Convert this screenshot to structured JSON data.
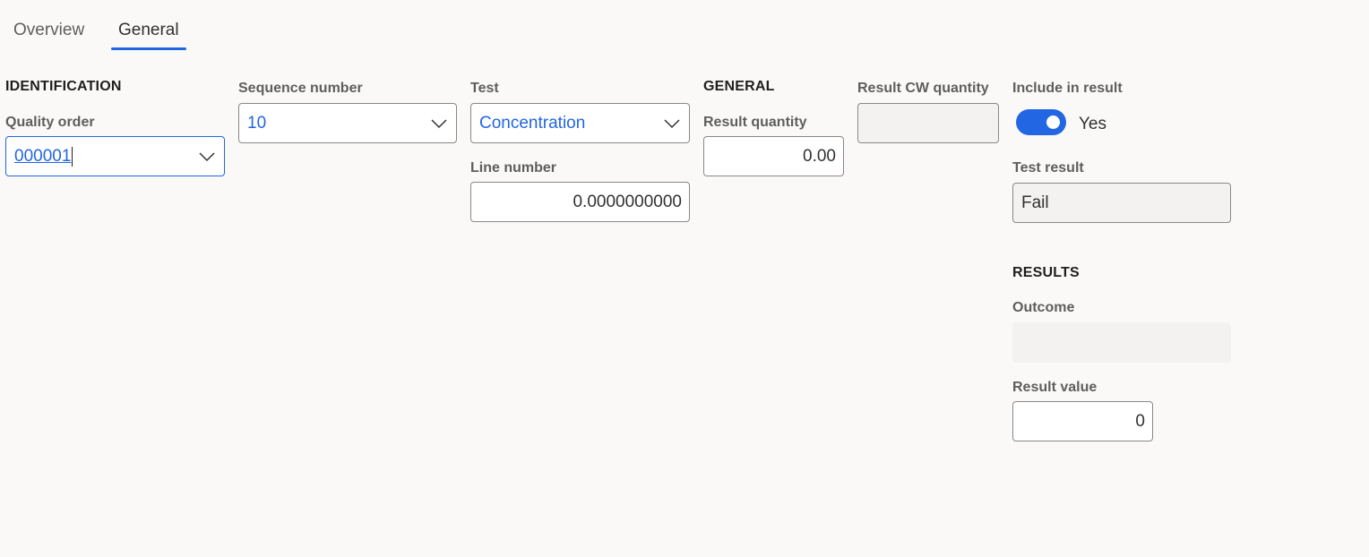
{
  "tabs": [
    {
      "label": "Overview",
      "active": false
    },
    {
      "label": "General",
      "active": true
    }
  ],
  "identification": {
    "heading": "IDENTIFICATION",
    "quality_order": {
      "label": "Quality order",
      "value": "000001"
    },
    "sequence_number": {
      "label": "Sequence number",
      "value": "10"
    },
    "test": {
      "label": "Test",
      "value": "Concentration"
    },
    "line_number": {
      "label": "Line number",
      "value": "0.0000000000"
    }
  },
  "general": {
    "heading": "GENERAL",
    "result_quantity": {
      "label": "Result quantity",
      "value": "0.00"
    },
    "result_cw_quantity": {
      "label": "Result CW quantity",
      "value": ""
    },
    "include_in_result": {
      "label": "Include in result",
      "value": "Yes",
      "on": true
    },
    "test_result": {
      "label": "Test result",
      "value": "Fail"
    }
  },
  "results": {
    "heading": "RESULTS",
    "outcome": {
      "label": "Outcome",
      "value": ""
    },
    "result_value": {
      "label": "Result value",
      "value": "0"
    }
  },
  "colors": {
    "accent": "#2266e3",
    "background": "#faf9f8",
    "readonly": "#f3f2f1"
  },
  "icons": {
    "dropdown": "chevron-down-icon"
  }
}
